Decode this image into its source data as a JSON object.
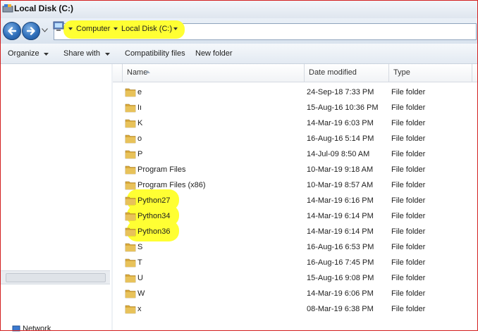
{
  "window": {
    "title": "Local Disk (C:)"
  },
  "address": {
    "crumbs": [
      {
        "label": "Computer"
      },
      {
        "label": "Local Disk (C:)"
      }
    ]
  },
  "commands": {
    "organize": "Organize",
    "share_with": "Share with",
    "compatibility": "Compatibility files",
    "new_folder": "New folder"
  },
  "columns": {
    "name": "Name",
    "date_modified": "Date modified",
    "type": "Type"
  },
  "files": [
    {
      "name": "e",
      "date": "24-Sep-18 7:33 PM",
      "type": "File folder",
      "highlighted": false
    },
    {
      "name": "Iı",
      "date": "15-Aug-16 10:36 PM",
      "type": "File folder",
      "highlighted": false
    },
    {
      "name": "K",
      "date": "14-Mar-19 6:03 PM",
      "type": "File folder",
      "highlighted": false
    },
    {
      "name": "o",
      "date": "16-Aug-16 5:14 PM",
      "type": "File folder",
      "highlighted": false
    },
    {
      "name": "P",
      "date": "14-Jul-09 8:50 AM",
      "type": "File folder",
      "highlighted": false
    },
    {
      "name": "Program Files",
      "date": "10-Mar-19 9:18 AM",
      "type": "File folder",
      "highlighted": false
    },
    {
      "name": "Program Files (x86)",
      "date": "10-Mar-19 8:57 AM",
      "type": "File folder",
      "highlighted": false
    },
    {
      "name": "Python27",
      "date": "14-Mar-19 6:16 PM",
      "type": "File folder",
      "highlighted": true
    },
    {
      "name": "Python34",
      "date": "14-Mar-19 6:14 PM",
      "type": "File folder",
      "highlighted": true
    },
    {
      "name": "Python36",
      "date": "14-Mar-19 6:14 PM",
      "type": "File folder",
      "highlighted": true
    },
    {
      "name": "S",
      "date": "16-Aug-16 6:53 PM",
      "type": "File folder",
      "highlighted": false
    },
    {
      "name": "T",
      "date": "16-Aug-16 7:45 PM",
      "type": "File folder",
      "highlighted": false
    },
    {
      "name": "U",
      "date": "15-Aug-16 9:08 PM",
      "type": "File folder",
      "highlighted": false
    },
    {
      "name": "W",
      "date": "14-Mar-19 6:06 PM",
      "type": "File folder",
      "highlighted": false
    },
    {
      "name": "x",
      "date": "08-Mar-19 6:38 PM",
      "type": "File folder",
      "highlighted": false
    }
  ],
  "nav": {
    "network_label": "Network"
  },
  "colors": {
    "highlight": "#ffff33",
    "folder": "#e8c25a",
    "nav_button": "#2f6fba"
  }
}
